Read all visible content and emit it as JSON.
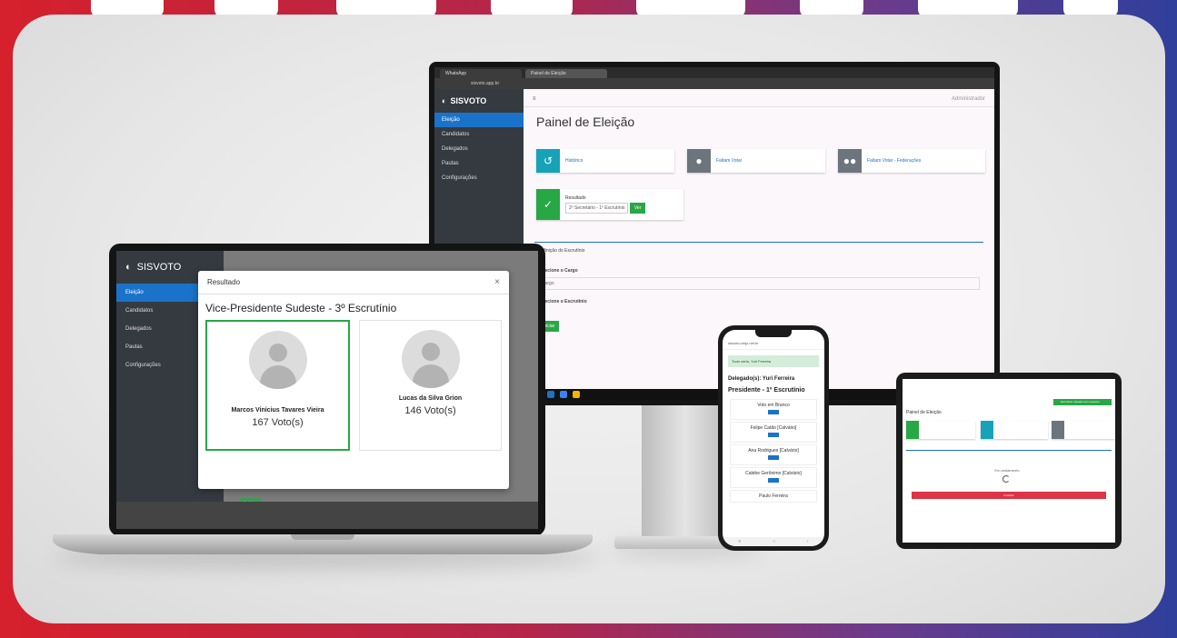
{
  "monitor": {
    "tabs": [
      "WhatsApp",
      "Painel de Eleição"
    ],
    "url": "sisvoto.app.br",
    "app_name": "SISVOTO",
    "sidebar": [
      "Eleição",
      "Candidatos",
      "Delegados",
      "Pautas",
      "Configurações"
    ],
    "user": "Administrador",
    "page_title": "Painel de Eleição",
    "cards": {
      "historico": "Histórico",
      "faltam_votar": "Faltam Votar",
      "faltam_votar_federacoes": "Faltam Votar - Federações"
    },
    "resultado": {
      "label": "Resultado",
      "select": "2º Secretário - 1º Escrutínio",
      "button": "Ver"
    },
    "form": {
      "section": "Definição do Escrutínio",
      "cargo_label": "Selecione o Cargo",
      "cargo_value": "Cargo",
      "escrutinio_label": "Selecione o Escrutínio",
      "start_button": "Iniciar"
    }
  },
  "laptop": {
    "app_name": "SISVOTO",
    "sidebar": [
      "Eleição",
      "Candidatos",
      "Delegados",
      "Pautas",
      "Configurações"
    ],
    "start_button": "Iniciar"
  },
  "modal": {
    "header": "Resultado",
    "close": "×",
    "title": "Vice-Presidente Sudeste - 3º Escrutínio",
    "candidates": [
      {
        "name": "Marcos Vinícius Tavares Vieira",
        "votes": "167 Voto(s)",
        "winner": true
      },
      {
        "name": "Lucas da Silva Grion",
        "votes": "146 Voto(s)",
        "winner": false
      }
    ]
  },
  "phone": {
    "url": "sisvoto.umju.net.br",
    "alert": "Tudo certo, Yuri Ferreira",
    "delegate": "Delegado(s): Yuri Ferreira",
    "position": "Presidente - 1º Escrutínio",
    "options": [
      "Voto em Branco",
      "Felipe Catão [Calvário]",
      "Ana Rodrigues [Calvário]",
      "Calebe Gerônimo [Calvário]",
      "Paulo Ferreira"
    ],
    "vote_label": "Votar"
  },
  "tablet": {
    "title": "Painel de Eleição",
    "success": "Escrutínio iniciado com sucesso",
    "loading": "Em andamento",
    "finish_button": "Finalizar"
  },
  "colors": {
    "brand_blue": "#1a73c9",
    "green": "#28a745",
    "teal": "#17a2b8",
    "red": "#dc3545"
  }
}
